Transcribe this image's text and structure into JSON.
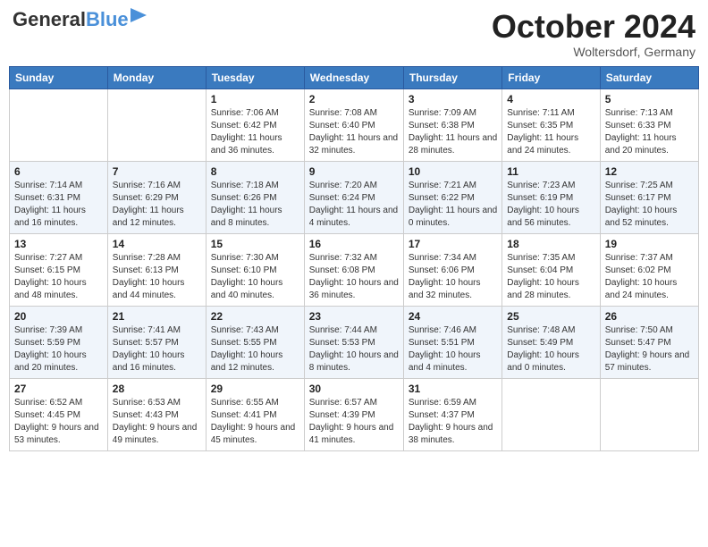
{
  "header": {
    "logo_general": "General",
    "logo_blue": "Blue",
    "month": "October 2024",
    "location": "Woltersdorf, Germany"
  },
  "weekdays": [
    "Sunday",
    "Monday",
    "Tuesday",
    "Wednesday",
    "Thursday",
    "Friday",
    "Saturday"
  ],
  "weeks": [
    [
      {
        "day": "",
        "info": ""
      },
      {
        "day": "",
        "info": ""
      },
      {
        "day": "1",
        "info": "Sunrise: 7:06 AM\nSunset: 6:42 PM\nDaylight: 11 hours and 36 minutes."
      },
      {
        "day": "2",
        "info": "Sunrise: 7:08 AM\nSunset: 6:40 PM\nDaylight: 11 hours and 32 minutes."
      },
      {
        "day": "3",
        "info": "Sunrise: 7:09 AM\nSunset: 6:38 PM\nDaylight: 11 hours and 28 minutes."
      },
      {
        "day": "4",
        "info": "Sunrise: 7:11 AM\nSunset: 6:35 PM\nDaylight: 11 hours and 24 minutes."
      },
      {
        "day": "5",
        "info": "Sunrise: 7:13 AM\nSunset: 6:33 PM\nDaylight: 11 hours and 20 minutes."
      }
    ],
    [
      {
        "day": "6",
        "info": "Sunrise: 7:14 AM\nSunset: 6:31 PM\nDaylight: 11 hours and 16 minutes."
      },
      {
        "day": "7",
        "info": "Sunrise: 7:16 AM\nSunset: 6:29 PM\nDaylight: 11 hours and 12 minutes."
      },
      {
        "day": "8",
        "info": "Sunrise: 7:18 AM\nSunset: 6:26 PM\nDaylight: 11 hours and 8 minutes."
      },
      {
        "day": "9",
        "info": "Sunrise: 7:20 AM\nSunset: 6:24 PM\nDaylight: 11 hours and 4 minutes."
      },
      {
        "day": "10",
        "info": "Sunrise: 7:21 AM\nSunset: 6:22 PM\nDaylight: 11 hours and 0 minutes."
      },
      {
        "day": "11",
        "info": "Sunrise: 7:23 AM\nSunset: 6:19 PM\nDaylight: 10 hours and 56 minutes."
      },
      {
        "day": "12",
        "info": "Sunrise: 7:25 AM\nSunset: 6:17 PM\nDaylight: 10 hours and 52 minutes."
      }
    ],
    [
      {
        "day": "13",
        "info": "Sunrise: 7:27 AM\nSunset: 6:15 PM\nDaylight: 10 hours and 48 minutes."
      },
      {
        "day": "14",
        "info": "Sunrise: 7:28 AM\nSunset: 6:13 PM\nDaylight: 10 hours and 44 minutes."
      },
      {
        "day": "15",
        "info": "Sunrise: 7:30 AM\nSunset: 6:10 PM\nDaylight: 10 hours and 40 minutes."
      },
      {
        "day": "16",
        "info": "Sunrise: 7:32 AM\nSunset: 6:08 PM\nDaylight: 10 hours and 36 minutes."
      },
      {
        "day": "17",
        "info": "Sunrise: 7:34 AM\nSunset: 6:06 PM\nDaylight: 10 hours and 32 minutes."
      },
      {
        "day": "18",
        "info": "Sunrise: 7:35 AM\nSunset: 6:04 PM\nDaylight: 10 hours and 28 minutes."
      },
      {
        "day": "19",
        "info": "Sunrise: 7:37 AM\nSunset: 6:02 PM\nDaylight: 10 hours and 24 minutes."
      }
    ],
    [
      {
        "day": "20",
        "info": "Sunrise: 7:39 AM\nSunset: 5:59 PM\nDaylight: 10 hours and 20 minutes."
      },
      {
        "day": "21",
        "info": "Sunrise: 7:41 AM\nSunset: 5:57 PM\nDaylight: 10 hours and 16 minutes."
      },
      {
        "day": "22",
        "info": "Sunrise: 7:43 AM\nSunset: 5:55 PM\nDaylight: 10 hours and 12 minutes."
      },
      {
        "day": "23",
        "info": "Sunrise: 7:44 AM\nSunset: 5:53 PM\nDaylight: 10 hours and 8 minutes."
      },
      {
        "day": "24",
        "info": "Sunrise: 7:46 AM\nSunset: 5:51 PM\nDaylight: 10 hours and 4 minutes."
      },
      {
        "day": "25",
        "info": "Sunrise: 7:48 AM\nSunset: 5:49 PM\nDaylight: 10 hours and 0 minutes."
      },
      {
        "day": "26",
        "info": "Sunrise: 7:50 AM\nSunset: 5:47 PM\nDaylight: 9 hours and 57 minutes."
      }
    ],
    [
      {
        "day": "27",
        "info": "Sunrise: 6:52 AM\nSunset: 4:45 PM\nDaylight: 9 hours and 53 minutes."
      },
      {
        "day": "28",
        "info": "Sunrise: 6:53 AM\nSunset: 4:43 PM\nDaylight: 9 hours and 49 minutes."
      },
      {
        "day": "29",
        "info": "Sunrise: 6:55 AM\nSunset: 4:41 PM\nDaylight: 9 hours and 45 minutes."
      },
      {
        "day": "30",
        "info": "Sunrise: 6:57 AM\nSunset: 4:39 PM\nDaylight: 9 hours and 41 minutes."
      },
      {
        "day": "31",
        "info": "Sunrise: 6:59 AM\nSunset: 4:37 PM\nDaylight: 9 hours and 38 minutes."
      },
      {
        "day": "",
        "info": ""
      },
      {
        "day": "",
        "info": ""
      }
    ]
  ]
}
